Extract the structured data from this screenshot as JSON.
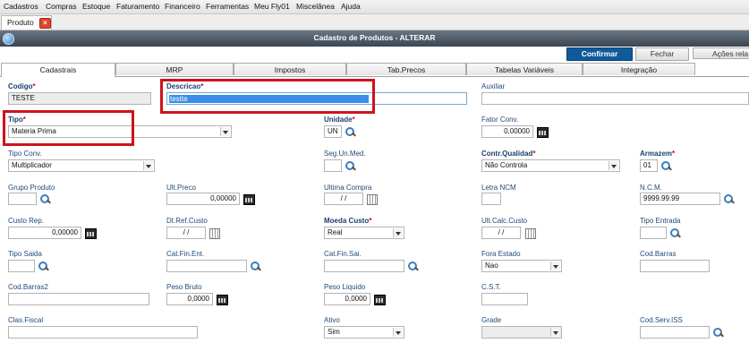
{
  "menu": [
    "Cadastros",
    "Compras",
    "Estoque",
    "Faturamento",
    "Financeiro",
    "Ferramentas",
    "Meu Fly01",
    "Miscelânea",
    "Ajuda"
  ],
  "doc_tab": {
    "label": "Produto",
    "close": "×"
  },
  "window": {
    "title": "Cadastro de Produtos - ALTERAR"
  },
  "buttons": {
    "confirm": "Confirmar",
    "close": "Fechar",
    "actions": "Ações rela"
  },
  "folders": [
    "Cadastrais",
    "MRP",
    "Impostos",
    "Tab.Precos",
    "Tabelas Variáveis",
    "Integração"
  ],
  "required_mark": "*",
  "fields": {
    "codigo": {
      "label": "Codigo",
      "value": "TESTE"
    },
    "descricao": {
      "label": "Descricao",
      "value": "testte"
    },
    "auxiliar": {
      "label": "Auxiliar",
      "value": ""
    },
    "tipo": {
      "label": "Tipo",
      "value": "Materia Prima"
    },
    "unidade": {
      "label": "Unidade",
      "value": "UN"
    },
    "fator_conv": {
      "label": "Fator Conv.",
      "value": "0,00000"
    },
    "tipo_conv": {
      "label": "Tipo Conv.",
      "value": "Multiplicador"
    },
    "seg_un_med": {
      "label": "Seg.Un.Med.",
      "value": ""
    },
    "contr_qualidade": {
      "label": "Contr.Qualidad",
      "value": "Não Controla"
    },
    "armazem": {
      "label": "Armazem",
      "value": "01"
    },
    "grupo_produto": {
      "label": "Grupo Produto",
      "value": ""
    },
    "ult_preco": {
      "label": "Ult.Preco",
      "value": "0,00000"
    },
    "ultima_compra": {
      "label": "Ultima Compra",
      "value": "/ /"
    },
    "letra_ncm": {
      "label": "Letra NCM",
      "value": ""
    },
    "ncm": {
      "label": "N.C.M.",
      "value": "9999.99.99"
    },
    "custo_rep": {
      "label": "Custo Rep.",
      "value": "0,00000"
    },
    "dt_ref_custo": {
      "label": "Dt.Ref.Custo",
      "value": "/ /"
    },
    "moeda_custo": {
      "label": "Moeda Custo",
      "value": "Real"
    },
    "ult_calc_custo": {
      "label": "Ult.Calc.Custo",
      "value": "/ /"
    },
    "tipo_entrada": {
      "label": "Tipo Entrada",
      "value": ""
    },
    "tipo_saida": {
      "label": "Tipo Saida",
      "value": ""
    },
    "cat_fin_ent": {
      "label": "Cat.Fin.Ent.",
      "value": ""
    },
    "cat_fin_sai": {
      "label": "Cat.Fin.Sai.",
      "value": ""
    },
    "fora_estado": {
      "label": "Fora Estado",
      "value": "Nao"
    },
    "cod_barras": {
      "label": "Cod.Barras",
      "value": ""
    },
    "cod_barras2": {
      "label": "Cod.Barras2",
      "value": ""
    },
    "peso_bruto": {
      "label": "Peso Bruto",
      "value": "0,0000"
    },
    "peso_liquido": {
      "label": "Peso Liquido",
      "value": "0,0000"
    },
    "cst": {
      "label": "C.S.T.",
      "value": ""
    },
    "clas_fiscal": {
      "label": "Clas.Fiscal",
      "value": ""
    },
    "ativo": {
      "label": "Ativo",
      "value": "Sim"
    },
    "grade": {
      "label": "Grade",
      "value": ""
    },
    "cod_serv_iss": {
      "label": "Cod.Serv.ISS",
      "value": ""
    }
  },
  "colors": {
    "highlight": "#d0121b",
    "confirm": "#0e5a9c",
    "label": "#1f4a7a",
    "titlebar": "#4a5563"
  }
}
